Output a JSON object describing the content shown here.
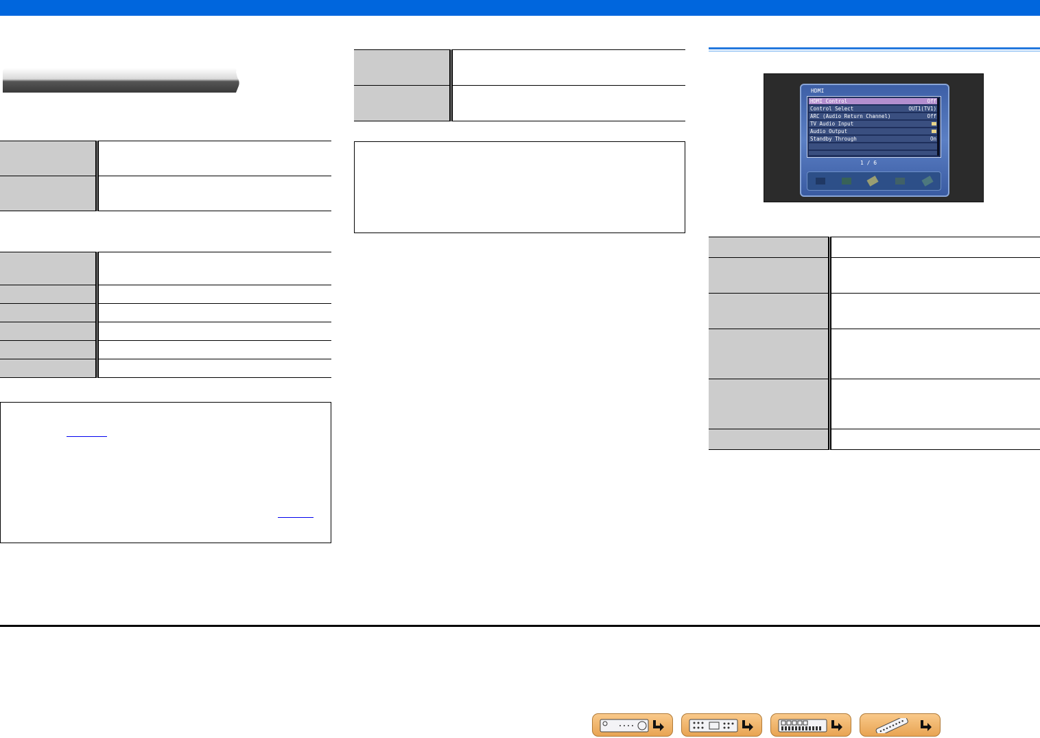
{
  "osd": {
    "title": "HDMI",
    "rows": [
      {
        "label": "HDMI Control",
        "value": "Off"
      },
      {
        "label": "Control Select",
        "value": "OUT1(TV1)"
      },
      {
        "label": "ARC (Audio Return Channel)",
        "value": "Off"
      },
      {
        "label": "TV Audio Input",
        "value": ""
      },
      {
        "label": "Audio Output",
        "value": ""
      },
      {
        "label": "Standby Through",
        "value": "On"
      }
    ],
    "page": "1 / 6"
  },
  "nav_buttons": [
    {
      "icon": "front-panel-icon"
    },
    {
      "icon": "rear-panel-icon"
    },
    {
      "icon": "display-panel-icon"
    },
    {
      "icon": "remote-control-icon"
    }
  ],
  "colors": {
    "top_bar": "#0066dd",
    "table_key_cell": "#cccccc",
    "nav_button": "#f0b46a",
    "osd_selected_row": "#b38fcf"
  }
}
